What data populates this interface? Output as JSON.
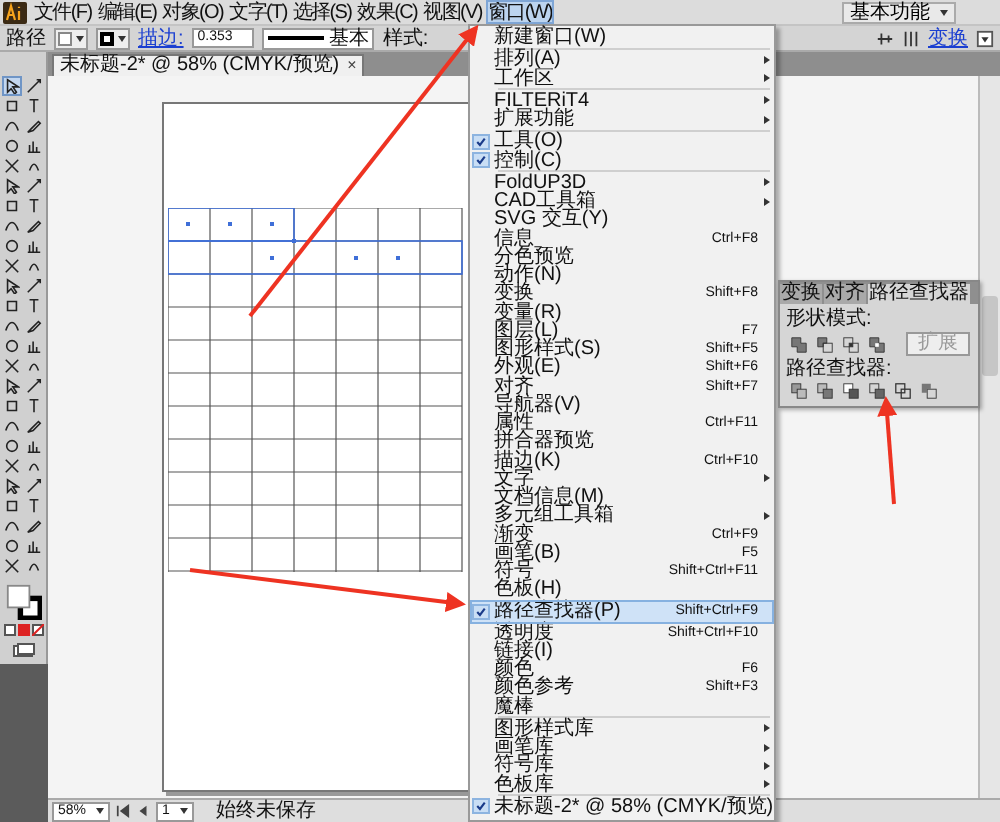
{
  "menubar": {
    "items": [
      {
        "label": "文件(F)",
        "selected": false
      },
      {
        "label": "编辑(E)",
        "selected": false
      },
      {
        "label": "对象(O)",
        "selected": false
      },
      {
        "label": "文字(T)",
        "selected": false
      },
      {
        "label": "选择(S)",
        "selected": false
      },
      {
        "label": "效果(C)",
        "selected": false
      },
      {
        "label": "视图(V)",
        "selected": false
      },
      {
        "label": "窗口(W)",
        "selected": true
      }
    ],
    "workspace": "基本功能"
  },
  "control_bar": {
    "object_type": "路径",
    "stroke_label": "描边:",
    "stroke_weight": "0.353",
    "brush": "基本",
    "style_label": "样式:",
    "transform_link": "变换"
  },
  "document_tab": {
    "title": "未标题-2* @ 58% (CMYK/预览)",
    "close": "×"
  },
  "tools": [
    {
      "selected": true
    },
    {
      "selected": false
    },
    {
      "selected": false
    },
    {
      "selected": false
    },
    {
      "selected": false
    },
    {
      "selected": false
    },
    {
      "selected": false
    },
    {
      "selected": false
    },
    {
      "selected": false
    },
    {
      "selected": false
    },
    {
      "selected": false
    },
    {
      "selected": false
    },
    {
      "selected": false
    },
    {
      "selected": false
    },
    {
      "selected": false
    },
    {
      "selected": false
    },
    {
      "selected": false
    },
    {
      "selected": false
    },
    {
      "selected": false
    },
    {
      "selected": false
    },
    {
      "selected": false
    },
    {
      "selected": false
    },
    {
      "selected": false
    },
    {
      "selected": false
    },
    {
      "selected": false
    },
    {
      "selected": false
    },
    {
      "selected": false
    },
    {
      "selected": false
    },
    {
      "selected": false
    },
    {
      "selected": false
    },
    {
      "selected": false
    },
    {
      "selected": false
    },
    {
      "selected": false
    },
    {
      "selected": false
    },
    {
      "selected": false
    },
    {
      "selected": false
    },
    {
      "selected": false
    },
    {
      "selected": false
    },
    {
      "selected": false
    },
    {
      "selected": false
    },
    {
      "selected": false
    },
    {
      "selected": false
    },
    {
      "selected": false
    },
    {
      "selected": false
    },
    {
      "selected": false
    },
    {
      "selected": false
    },
    {
      "selected": false
    },
    {
      "selected": false
    },
    {
      "selected": false
    },
    {
      "selected": false
    }
  ],
  "window_menu": {
    "items": [
      {
        "kind": "item",
        "label": "新建窗口(W)",
        "checked": false,
        "submenu": false,
        "selected": false
      },
      {
        "kind": "separator"
      },
      {
        "kind": "item",
        "label": "排列(A)",
        "checked": false,
        "submenu": true,
        "selected": false
      },
      {
        "kind": "item",
        "label": "工作区",
        "checked": false,
        "submenu": true,
        "selected": false
      },
      {
        "kind": "separator"
      },
      {
        "kind": "item",
        "label": "FILTERiT4",
        "checked": false,
        "submenu": true,
        "selected": false
      },
      {
        "kind": "item",
        "label": "扩展功能",
        "checked": false,
        "submenu": true,
        "selected": false
      },
      {
        "kind": "separator"
      },
      {
        "kind": "item",
        "label": "工具(O)",
        "checked": true,
        "submenu": false,
        "selected": false
      },
      {
        "kind": "item",
        "label": "控制(C)",
        "checked": true,
        "submenu": false,
        "selected": false
      },
      {
        "kind": "separator"
      },
      {
        "kind": "item",
        "label": "FoldUP3D",
        "checked": false,
        "submenu": true,
        "selected": false
      },
      {
        "kind": "item",
        "label": "CAD工具箱",
        "checked": false,
        "submenu": true,
        "selected": false
      },
      {
        "kind": "item",
        "label": "SVG 交互(Y)",
        "checked": false,
        "submenu": false,
        "selected": false
      },
      {
        "kind": "item",
        "label": "信息",
        "shortcut": "Ctrl+F8",
        "checked": false,
        "submenu": false,
        "selected": false
      },
      {
        "kind": "item",
        "label": "分色预览",
        "checked": false,
        "submenu": false,
        "selected": false
      },
      {
        "kind": "item",
        "label": "动作(N)",
        "checked": false,
        "submenu": false,
        "selected": false
      },
      {
        "kind": "item",
        "label": "变换",
        "shortcut": "Shift+F8",
        "checked": false,
        "submenu": false,
        "selected": false
      },
      {
        "kind": "item",
        "label": "变量(R)",
        "checked": false,
        "submenu": false,
        "selected": false
      },
      {
        "kind": "item",
        "label": "图层(L)",
        "shortcut": "F7",
        "checked": false,
        "submenu": false,
        "selected": false
      },
      {
        "kind": "item",
        "label": "图形样式(S)",
        "shortcut": "Shift+F5",
        "checked": false,
        "submenu": false,
        "selected": false
      },
      {
        "kind": "item",
        "label": "外观(E)",
        "shortcut": "Shift+F6",
        "checked": false,
        "submenu": false,
        "selected": false
      },
      {
        "kind": "item",
        "label": "对齐",
        "shortcut": "Shift+F7",
        "checked": false,
        "submenu": false,
        "selected": false
      },
      {
        "kind": "item",
        "label": "导航器(V)",
        "checked": false,
        "submenu": false,
        "selected": false
      },
      {
        "kind": "item",
        "label": "属性",
        "shortcut": "Ctrl+F11",
        "checked": false,
        "submenu": false,
        "selected": false
      },
      {
        "kind": "item",
        "label": "拼合器预览",
        "checked": false,
        "submenu": false,
        "selected": false
      },
      {
        "kind": "item",
        "label": "描边(K)",
        "shortcut": "Ctrl+F10",
        "checked": false,
        "submenu": false,
        "selected": false
      },
      {
        "kind": "item",
        "label": "文字",
        "checked": false,
        "submenu": true,
        "selected": false
      },
      {
        "kind": "item",
        "label": "文档信息(M)",
        "checked": false,
        "submenu": false,
        "selected": false
      },
      {
        "kind": "item",
        "label": "多元组工具箱",
        "checked": false,
        "submenu": true,
        "selected": false
      },
      {
        "kind": "item",
        "label": "渐变",
        "shortcut": "Ctrl+F9",
        "checked": false,
        "submenu": false,
        "selected": false
      },
      {
        "kind": "item",
        "label": "画笔(B)",
        "shortcut": "F5",
        "checked": false,
        "submenu": false,
        "selected": false
      },
      {
        "kind": "item",
        "label": "符号",
        "shortcut": "Shift+Ctrl+F11",
        "checked": false,
        "submenu": false,
        "selected": false
      },
      {
        "kind": "item",
        "label": "色板(H)",
        "checked": false,
        "submenu": false,
        "selected": false
      },
      {
        "kind": "item",
        "label": "路径查找器(P)",
        "shortcut": "Shift+Ctrl+F9",
        "checked": true,
        "submenu": false,
        "selected": true
      },
      {
        "kind": "item",
        "label": "透明度",
        "shortcut": "Shift+Ctrl+F10",
        "checked": false,
        "submenu": false,
        "selected": false
      },
      {
        "kind": "item",
        "label": "链接(I)",
        "checked": false,
        "submenu": false,
        "selected": false
      },
      {
        "kind": "item",
        "label": "颜色",
        "shortcut": "F6",
        "checked": false,
        "submenu": false,
        "selected": false
      },
      {
        "kind": "item",
        "label": "颜色参考",
        "shortcut": "Shift+F3",
        "checked": false,
        "submenu": false,
        "selected": false
      },
      {
        "kind": "item",
        "label": "魔棒",
        "checked": false,
        "submenu": false,
        "selected": false
      },
      {
        "kind": "separator"
      },
      {
        "kind": "item",
        "label": "图形样式库",
        "checked": false,
        "submenu": true,
        "selected": false
      },
      {
        "kind": "item",
        "label": "画笔库",
        "checked": false,
        "submenu": true,
        "selected": false
      },
      {
        "kind": "item",
        "label": "符号库",
        "checked": false,
        "submenu": true,
        "selected": false
      },
      {
        "kind": "item",
        "label": "色板库",
        "checked": false,
        "submenu": true,
        "selected": false
      },
      {
        "kind": "separator"
      },
      {
        "kind": "item",
        "label": "未标题-2* @ 58% (CMYK/预览)",
        "checked": true,
        "submenu": false,
        "selected": false
      }
    ]
  },
  "pathfinder_panel": {
    "tabs": [
      {
        "label": "变换",
        "selected": false
      },
      {
        "label": "对齐",
        "selected": false
      },
      {
        "label": "路径查找器",
        "selected": true
      }
    ],
    "shape_modes_label": "形状模式:",
    "expand_button": {
      "label": "扩展",
      "disabled": true
    },
    "pathfinders_label": "路径查找器:"
  },
  "status_bar": {
    "zoom": "58%",
    "page": "1",
    "status": "始终未保存"
  }
}
